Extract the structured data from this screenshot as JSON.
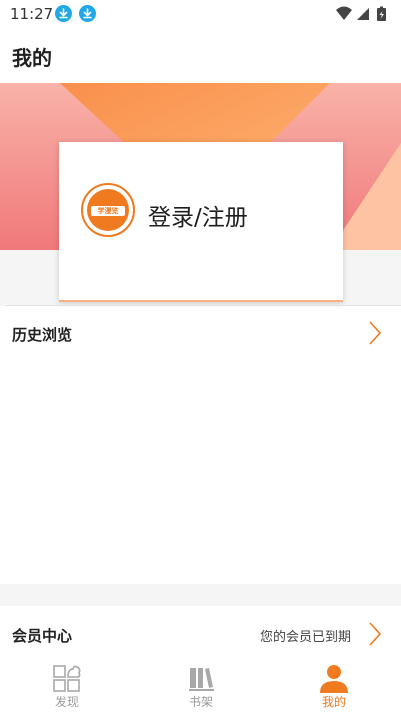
{
  "status_bar": {
    "time": "11:27"
  },
  "page_title": "我的",
  "login_card": {
    "logo_text": "学漫览",
    "action_label": "登录/注册"
  },
  "history_row": {
    "label": "历史浏览"
  },
  "member_row": {
    "label": "会员中心",
    "status": "您的会员已到期"
  },
  "tabs": [
    {
      "label": "发现",
      "icon": "discover-grid-icon",
      "active": false
    },
    {
      "label": "书架",
      "icon": "bookshelf-icon",
      "active": false
    },
    {
      "label": "我的",
      "icon": "profile-person-icon",
      "active": true
    }
  ],
  "colors": {
    "accent": "#ef7a1f",
    "banner_pink": "#f7a8a0",
    "banner_orange": "#fb9d53",
    "download_blue": "#21a8e6"
  }
}
